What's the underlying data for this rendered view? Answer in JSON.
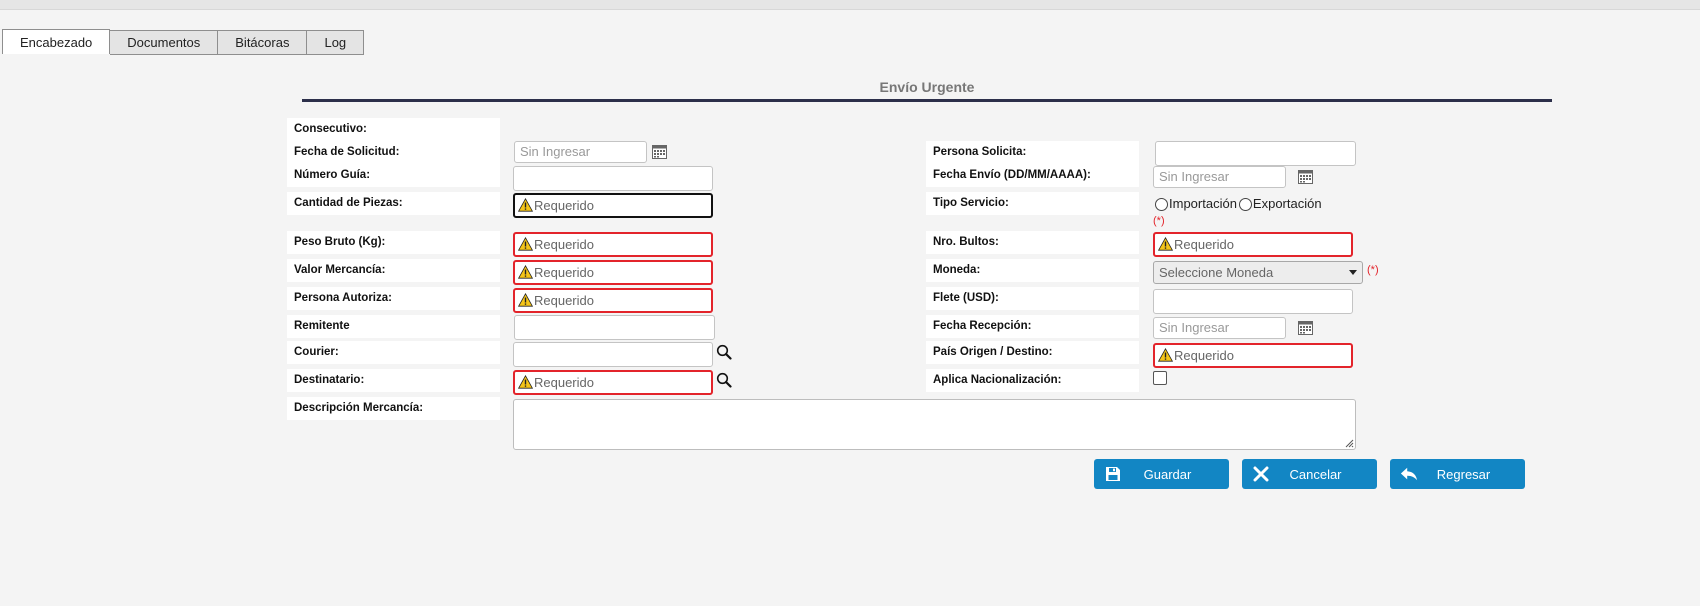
{
  "tabs": [
    "Encabezado",
    "Documentos",
    "Bitácoras",
    "Log"
  ],
  "title": "Envío Urgente",
  "left_labels": {
    "consecutivo": "Consecutivo:",
    "fecha_solicitud": "Fecha de Solicitud:",
    "numero_guia": "Número Guía:",
    "cantidad_piezas": "Cantidad de Piezas:",
    "peso_bruto": "Peso Bruto (Kg):",
    "valor_mercancia": "Valor Mercancía:",
    "persona_autoriza": "Persona Autoriza:",
    "remitente": "Remitente",
    "courier": "Courier:",
    "destinatario": "Destinatario:",
    "descripcion": "Descripción Mercancía:"
  },
  "right_labels": {
    "persona_solicita": "Persona Solicita:",
    "fecha_envio": "Fecha Envío (DD/MM/AAAA):",
    "tipo_servicio": "Tipo Servicio:",
    "nro_bultos": "Nro. Bultos:",
    "moneda": "Moneda:",
    "flete": "Flete (USD):",
    "fecha_recepcion": "Fecha Recepción:",
    "pais": "País Origen / Destino:",
    "aplica_nacionalizacion": "Aplica Nacionalización:"
  },
  "placeholders": {
    "sin_ingresar": "Sin Ingresar",
    "requerido": "Requerido",
    "seleccione_moneda": "Seleccione Moneda"
  },
  "tipo_servicio_options": [
    "Importación",
    "Exportación"
  ],
  "required_mark": "(*)",
  "buttons": {
    "guardar": "Guardar",
    "cancelar": "Cancelar",
    "regresar": "Regresar"
  },
  "colors": {
    "accent": "#1286c4",
    "error": "#e3242b",
    "title_rule": "#2c2f4a"
  }
}
